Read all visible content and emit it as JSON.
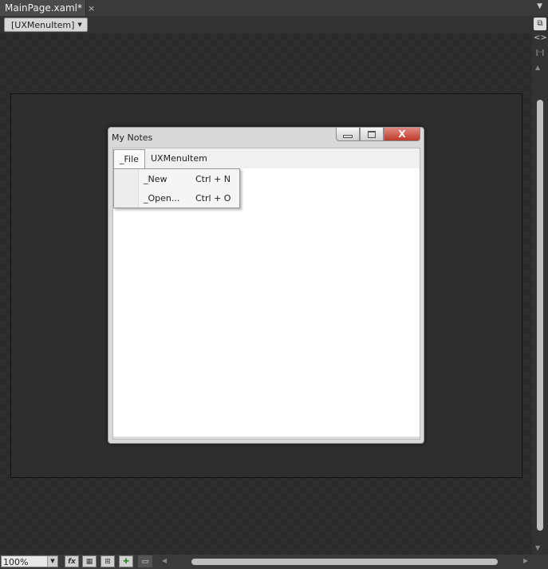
{
  "document_tab": {
    "title": "MainPage.xaml*",
    "close_glyph": "×"
  },
  "breadcrumb": {
    "label": "[UXMenuItem]"
  },
  "app_window": {
    "title": "My Notes",
    "close_glyph": "X",
    "menu": [
      {
        "label": "_File"
      },
      {
        "label": "UXMenuItem"
      }
    ],
    "file_dropdown": [
      {
        "label": "_New",
        "shortcut": "Ctrl + N"
      },
      {
        "label": "_Open...",
        "shortcut": "Ctrl + O"
      }
    ]
  },
  "bottom_bar": {
    "zoom": "100%"
  },
  "icons": {
    "tab_dropdown": "chevron-down-icon",
    "expand": "expand-icon",
    "code": "code-icon",
    "ruler": "ruler-icon",
    "fx": "fx-icon",
    "grid": "grid-icon",
    "snap_grid": "snap-grid-icon",
    "snap_lines": "snap-lines-icon",
    "annotation": "annotation-icon"
  },
  "colors": {
    "background": "#2b2b2b",
    "close_button": "#c1392b",
    "window_chrome": "#d9d9d9"
  }
}
